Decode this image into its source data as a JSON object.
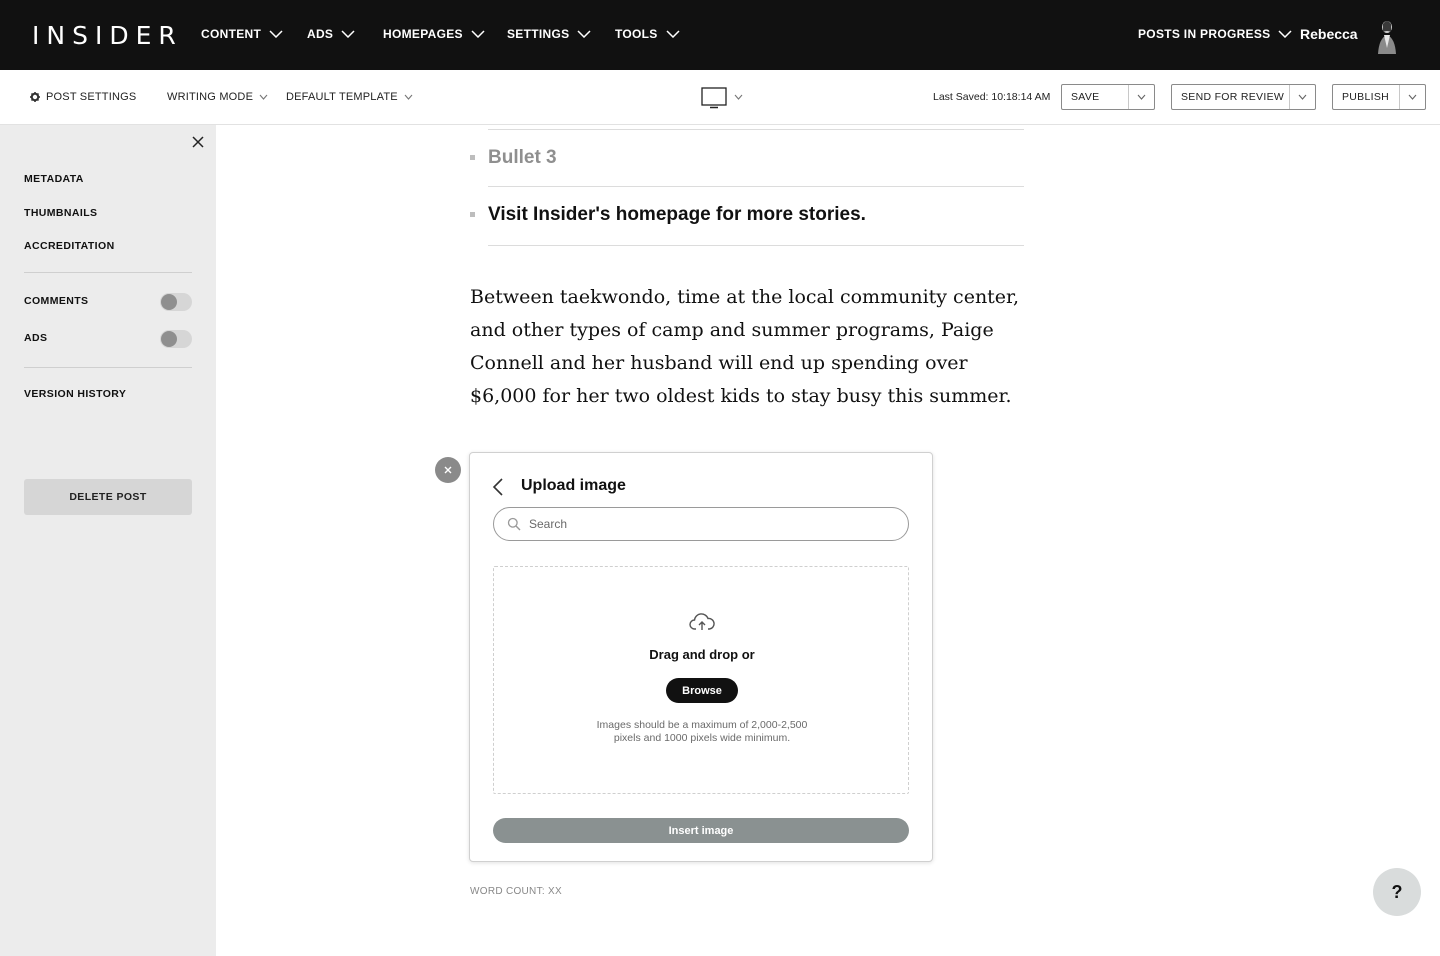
{
  "brand": {
    "logo": "INSIDER"
  },
  "topnav": {
    "items": [
      "CONTENT",
      "ADS",
      "HOMEPAGES",
      "SETTINGS",
      "TOOLS"
    ],
    "posts_in_progress": "POSTS IN PROGRESS",
    "user_name": "Rebecca"
  },
  "toolbar": {
    "post_settings": "POST SETTINGS",
    "writing_mode": "WRITING MODE",
    "template": "DEFAULT TEMPLATE",
    "last_saved": "Last Saved: 10:18:14 AM",
    "save": "SAVE",
    "send_for_review": "SEND FOR REVIEW",
    "publish": "PUBLISH"
  },
  "sidebar": {
    "links": [
      "METADATA",
      "THUMBNAILS",
      "ACCREDITATION"
    ],
    "toggles": [
      {
        "label": "COMMENTS",
        "on": false
      },
      {
        "label": "ADS",
        "on": false
      }
    ],
    "version_history": "VERSION HISTORY",
    "delete_post": "DELETE POST"
  },
  "editor": {
    "bullets": [
      {
        "text": "Bullet 3",
        "placeholder": true
      },
      {
        "text": "Visit Insider's homepage for more stories.",
        "placeholder": false
      }
    ],
    "paragraph": "Between taekwondo, time at the local community center, and other types of camp and summer programs, Paige Connell and her husband will end up spending over $6,000 for her two oldest kids to stay busy this summer.",
    "word_count": "WORD COUNT: XX"
  },
  "upload_image": {
    "title": "Upload image",
    "search_placeholder": "Search",
    "drag_text": "Drag and drop or",
    "browse": "Browse",
    "hint_line1": "Images should be a maximum of 2,000-2,500",
    "hint_line2": "pixels and 1000 pixels wide minimum.",
    "insert": "Insert image"
  },
  "help": {
    "label": "?"
  },
  "colors": {
    "nav_bg": "#111111",
    "sidebar_bg": "#ececec",
    "toggle_off": "#d6d6d6",
    "insert_btn": "#8a9191",
    "browse_btn": "#111111"
  },
  "icons": [
    "gear-icon",
    "chevron-down-icon",
    "monitor-icon",
    "close-icon",
    "back-chevron-icon",
    "search-icon",
    "cloud-upload-icon",
    "avatar"
  ]
}
